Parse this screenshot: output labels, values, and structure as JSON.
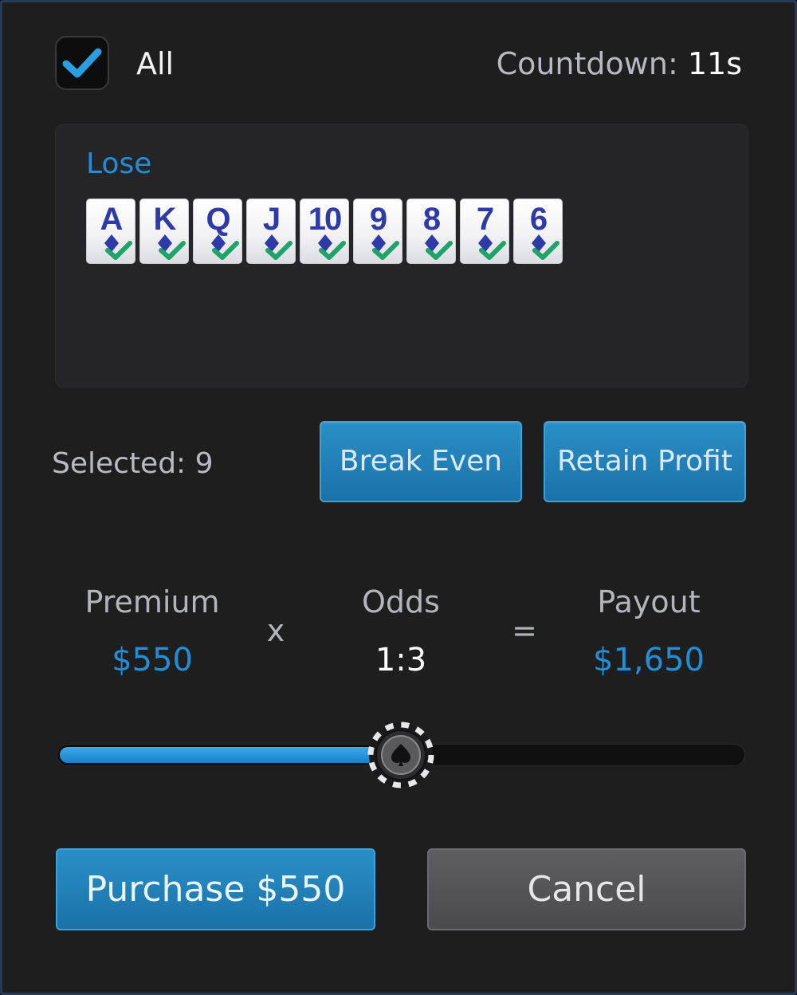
{
  "header": {
    "all_label": "All",
    "all_checked": true,
    "countdown_label": "Countdown:",
    "countdown_value": "11s"
  },
  "outs": {
    "section_label": "Lose",
    "cards": [
      {
        "rank": "A",
        "suit": "diamond",
        "checked": true
      },
      {
        "rank": "K",
        "suit": "diamond",
        "checked": true
      },
      {
        "rank": "Q",
        "suit": "diamond",
        "checked": true
      },
      {
        "rank": "J",
        "suit": "diamond",
        "checked": true
      },
      {
        "rank": "10",
        "suit": "diamond",
        "checked": true
      },
      {
        "rank": "9",
        "suit": "diamond",
        "checked": true
      },
      {
        "rank": "8",
        "suit": "diamond",
        "checked": true
      },
      {
        "rank": "7",
        "suit": "diamond",
        "checked": true
      },
      {
        "rank": "6",
        "suit": "diamond",
        "checked": true
      }
    ]
  },
  "selection": {
    "selected_text": "Selected: 9",
    "break_even_label": "Break Even",
    "retain_profit_label": "Retain Profit"
  },
  "calc": {
    "premium_label": "Premium",
    "premium_value": "$550",
    "times_op": "x",
    "odds_label": "Odds",
    "odds_value": "1:3",
    "equals_op": "=",
    "payout_label": "Payout",
    "payout_value": "$1,650"
  },
  "slider": {
    "fraction": 0.5,
    "thumb_icon": "spade-chip-icon"
  },
  "actions": {
    "purchase_label": "Purchase $550",
    "cancel_label": "Cancel"
  },
  "colors": {
    "accent": "#1f8fd9",
    "card_ink": "#2d3aa8",
    "check_green": "#1fa36a"
  }
}
